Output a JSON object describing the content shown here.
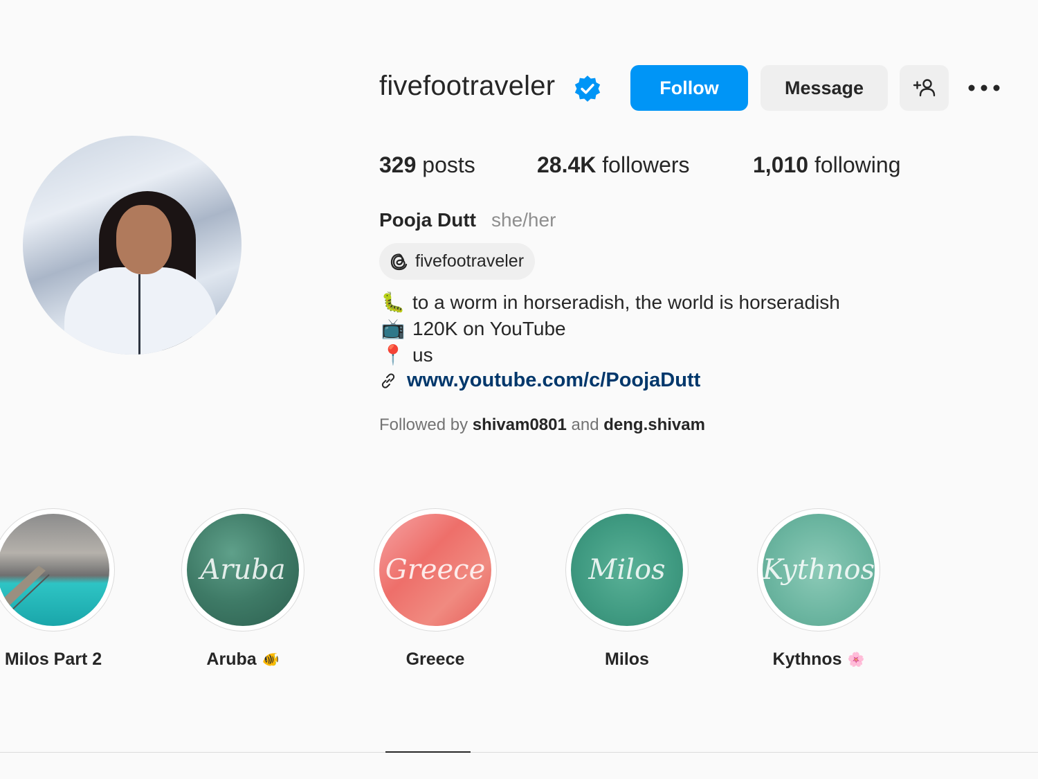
{
  "profile": {
    "username": "fivefootraveler",
    "full_name": "Pooja Dutt",
    "pronouns": "she/her",
    "threads_handle": "fivefootraveler"
  },
  "actions": {
    "follow_label": "Follow",
    "message_label": "Message"
  },
  "stats": {
    "posts_count": "329",
    "posts_label": "posts",
    "followers_count": "28.4K",
    "followers_label": "followers",
    "following_count": "1,010",
    "following_label": "following"
  },
  "bio": {
    "line1_emoji": "🐛",
    "line1_text": "to a worm in horseradish, the world is horseradish",
    "line2_emoji": "📺",
    "line2_text": "120K on YouTube",
    "line3_emoji": "📍",
    "line3_text": "us",
    "link": "www.youtube.com/c/PoojaDutt"
  },
  "followed_by": {
    "prefix": "Followed by",
    "user1": "shivam0801",
    "conjunction": "and",
    "user2": "deng.shivam"
  },
  "highlights": [
    {
      "label": "Milos Part 2",
      "cover_text": ""
    },
    {
      "label": "Aruba",
      "cover_text": "Aruba",
      "emoji": "🐠"
    },
    {
      "label": "Greece",
      "cover_text": "Greece"
    },
    {
      "label": "Milos",
      "cover_text": "Milos"
    },
    {
      "label": "Kythnos",
      "cover_text": "Kythnos",
      "emoji": "🌸"
    }
  ],
  "colors": {
    "primary_button": "#0095f6",
    "secondary_button": "#efefef",
    "verified_badge": "#0095f6",
    "link": "#00376b"
  }
}
